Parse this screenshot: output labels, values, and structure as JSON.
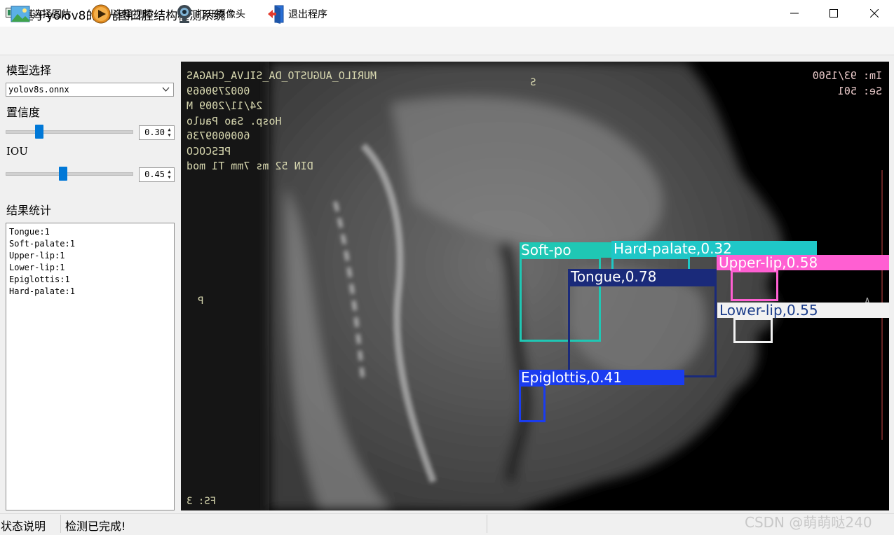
{
  "window": {
    "title": "基于yolov8的X光图口腔结构检测系统"
  },
  "toolbar": {
    "items": [
      {
        "label": "选择图片",
        "icon": "image-icon"
      },
      {
        "label": "选择视频",
        "icon": "play-icon"
      },
      {
        "label": "打开摄像头",
        "icon": "webcam-icon"
      },
      {
        "label": "退出程序",
        "icon": "exit-door-icon"
      }
    ]
  },
  "left_panel": {
    "model_label": "模型选择",
    "model_value": "yolov8s.onnx",
    "confidence_label": "置信度",
    "confidence_value": "0.30",
    "confidence_level": 0.3,
    "iou_label": "IOU",
    "iou_value": "0.45",
    "iou_level": 0.45,
    "result_label": "结果统计",
    "results": [
      "Tongue:1",
      "Soft-palate:1",
      "Upper-lip:1",
      "Lower-lip:1",
      "Epiglottis:1",
      "Hard-palate:1"
    ]
  },
  "image_view": {
    "overlay_text_left": [
      "MURILO_AUGUSTO_DA_SILVA_CHAGAS",
      "0002790669",
      "24/11/2009 M",
      "Hosp. Sao Paulo",
      "6000009736",
      "PESCOCO",
      "DIN  52 ms 7mm T1 mod"
    ],
    "overlay_text_right": [
      "Im: 93/1500",
      "Se: 501"
    ],
    "overlay_s": "S",
    "overlay_p": "P",
    "overlay_a": "A",
    "overlay_fs": "FS: 3",
    "detections": [
      {
        "label": "Soft-po",
        "color": "#1fc7b4"
      },
      {
        "label": "Hard-palate,0.32",
        "color": "#1fc7c7"
      },
      {
        "label": "Upper-lip,0.58",
        "color": "#ff5fd2"
      },
      {
        "label": "Tongue,0.78",
        "color": "#1a2a7a"
      },
      {
        "label": "Lower-lip,0.55",
        "color": "#f2f2f2"
      },
      {
        "label": "Epiglottis,0.41",
        "color": "#1a3cf0"
      }
    ]
  },
  "statusbar": {
    "title": "状态说明",
    "message": "检测已完成!"
  },
  "watermark": "CSDN @萌萌哒240"
}
